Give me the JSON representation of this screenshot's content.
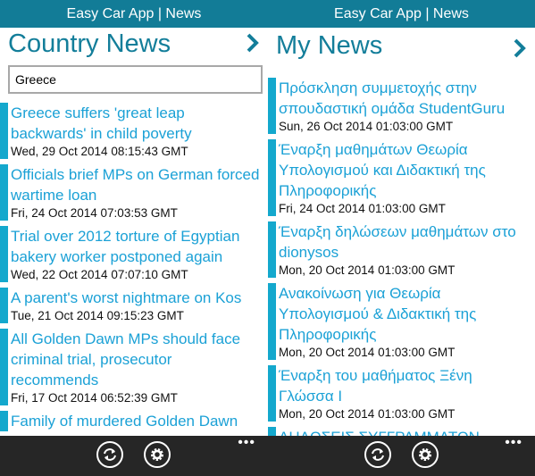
{
  "app_title": "Easy Car App | News",
  "colors": {
    "header": "#127c97",
    "accent": "#1ba1d6",
    "bar": "#14a8cd",
    "appbar": "#262626"
  },
  "country_news": {
    "title": "Country News",
    "search_value": "Greece",
    "items": [
      {
        "title": "Greece suffers 'great leap backwards' in child poverty",
        "date": "Wed, 29 Oct 2014 08:15:43 GMT"
      },
      {
        "title": "Officials brief MPs on German forced wartime loan",
        "date": "Fri, 24 Oct 2014 07:03:53 GMT"
      },
      {
        "title": "Trial over 2012 torture of Egyptian bakery worker postponed again",
        "date": "Wed, 22 Oct 2014 07:07:10 GMT"
      },
      {
        "title": "A parent's worst nightmare on Kos",
        "date": "Tue, 21 Oct 2014 09:15:23 GMT"
      },
      {
        "title": "All Golden Dawn MPs should face criminal trial, prosecutor recommends",
        "date": "Fri, 17 Oct 2014 06:52:39 GMT"
      },
      {
        "title": "Family of murdered Golden Dawn",
        "date": ""
      }
    ]
  },
  "my_news": {
    "title": "My News",
    "items": [
      {
        "title": "Πρόσκληση συμμετοχής  στην σπουδαστική ομάδα StudentGuru",
        "date": "Sun, 26 Oct 2014 01:03:00 GMT"
      },
      {
        "title": "Έναρξη μαθημάτων Θεωρία Υπολογισμού και Διδακτική της Πληροφορικής",
        "date": "Fri, 24 Oct 2014 01:03:00 GMT"
      },
      {
        "title": "Έναρξη δηλώσεων μαθημάτων στο dionysos",
        "date": "Mon, 20 Oct 2014 01:03:00 GMT"
      },
      {
        "title": "Ανακοίνωση για Θεωρία Υπολογισμού & Διδακτική της Πληροφορικής",
        "date": "Mon, 20 Oct 2014 01:03:00 GMT"
      },
      {
        "title": "Έναρξη του μαθήματος Ξένη Γλώσσα Ι",
        "date": "Mon, 20 Oct 2014 01:03:00 GMT"
      },
      {
        "title": "ΔΗΛΩΣΕΙΣ ΣΥΓΓΡΑΜΜΑΤΩΝ",
        "date": ""
      }
    ]
  },
  "appbar": {
    "icons": [
      "refresh-icon",
      "settings-icon"
    ],
    "more": "•••"
  }
}
